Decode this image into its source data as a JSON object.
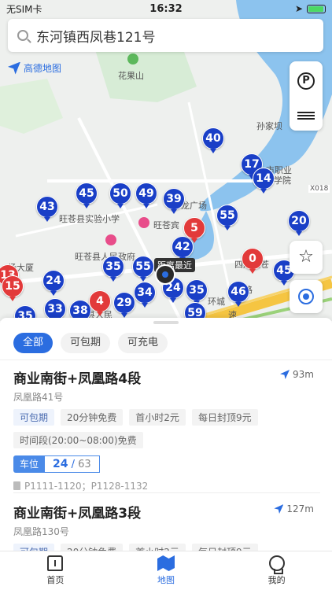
{
  "status_bar": {
    "carrier": "无SIM卡",
    "time": "16:32"
  },
  "search": {
    "query": "东河镇西凤巷121号"
  },
  "map": {
    "logo_text": "高德地图",
    "labels": [
      "花果山",
      "孙家坝",
      "市职业",
      "学院",
      "X018",
      "旺苍县实验小学",
      "龙广场",
      "旺苍宾",
      "旺苍县人民政府",
      "场大厦",
      "四川旺苍",
      "环城",
      "路",
      "速",
      "县人民"
    ],
    "nearest_label": "距离最近",
    "pins_blue": [
      40,
      17,
      14,
      45,
      50,
      49,
      39,
      43,
      55,
      20,
      42,
      24,
      35,
      55,
      45,
      34,
      24,
      35,
      46,
      33,
      38,
      29,
      35,
      59
    ],
    "pins_red": [
      5,
      0,
      13,
      15,
      4
    ]
  },
  "filters": {
    "all": "全部",
    "monthly": "可包期",
    "charging": "可充电"
  },
  "lots": [
    {
      "name": "商业南街+凤凰路4段",
      "distance": "93m",
      "address": "凤凰路41号",
      "tags": [
        "可包期",
        "20分钟免费",
        "首小时2元",
        "每日封顶9元"
      ],
      "extra_tag": "时间段(20:00~08:00)免费",
      "slot_label": "车位",
      "slot_free": "24",
      "slot_total": "63",
      "floors": "P1111-1120；P1128-1132"
    },
    {
      "name": "商业南街+凤凰路3段",
      "distance": "127m",
      "address": "凤凰路130号",
      "tags": [
        "可包期",
        "20分钟免费",
        "首小时2元",
        "每日封顶9元"
      ]
    }
  ],
  "tabbar": {
    "home": "首页",
    "map": "地图",
    "mine": "我的"
  }
}
